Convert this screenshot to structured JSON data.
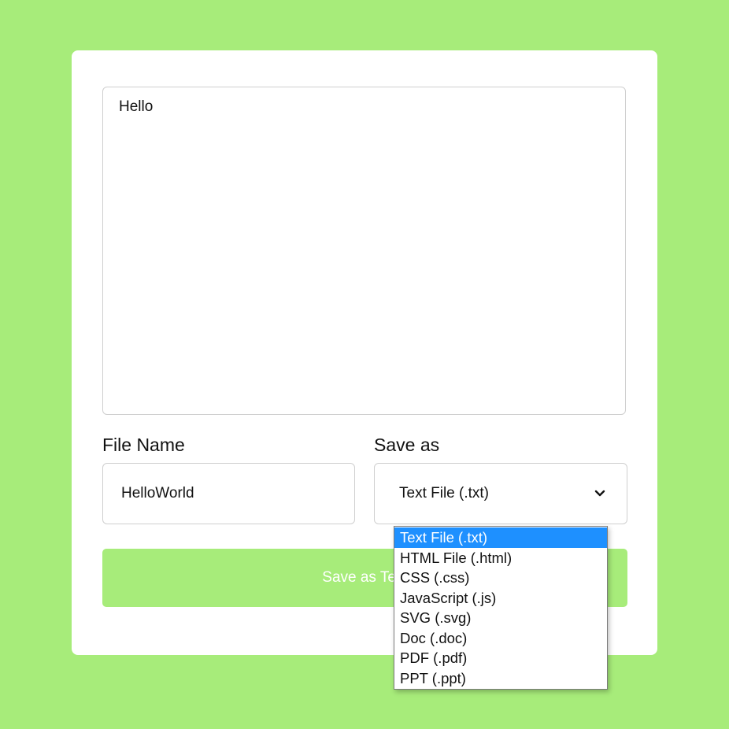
{
  "editor": {
    "content": "Hello"
  },
  "form": {
    "file_name_label": "File Name",
    "file_name_value": "HelloWorld",
    "save_as_label": "Save as",
    "save_as_value": "Text File (.txt)"
  },
  "save_button": {
    "label": "Save as Text"
  },
  "dropdown": {
    "selected_index": 0,
    "options": [
      "Text File (.txt)",
      "HTML File (.html)",
      "CSS (.css)",
      "JavaScript (.js)",
      "SVG (.svg)",
      "Doc (.doc)",
      "PDF (.pdf)",
      "PPT (.ppt)"
    ]
  },
  "colors": {
    "background": "#a7ec7a",
    "button": "#a7ec7a",
    "selected_option": "#1e90ff"
  },
  "icons": {
    "select_arrow": "chevron-down-icon"
  }
}
